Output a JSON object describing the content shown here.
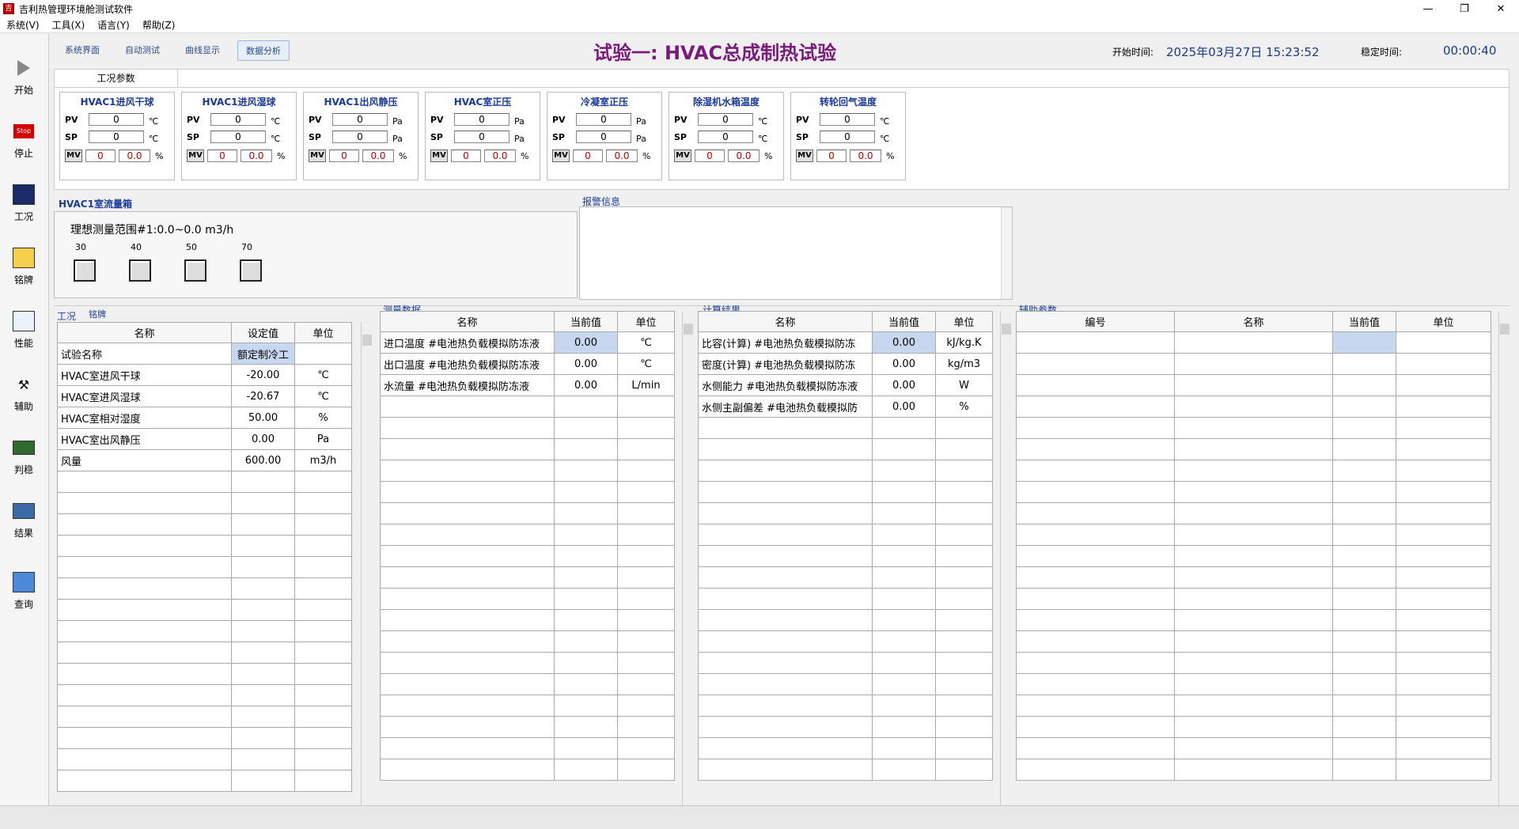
{
  "window": {
    "title": "吉利热管理环境舱测试软件",
    "minimize": "—",
    "maximize": "❐",
    "close": "✕"
  },
  "menu": [
    "系统(V)",
    "工具(X)",
    "语言(Y)",
    "帮助(Z)"
  ],
  "toolbar": [
    {
      "label": "开始",
      "icon": "play-icon"
    },
    {
      "label": "停止",
      "icon": "stop-icon",
      "icon_text": "Stop"
    },
    {
      "label": "工况",
      "icon": "condition-icon"
    },
    {
      "label": "铭牌",
      "icon": "nameplate-icon"
    },
    {
      "label": "性能",
      "icon": "performance-chart-icon"
    },
    {
      "label": "辅助",
      "icon": "assist-icon"
    },
    {
      "label": "判稳",
      "icon": "stability-icon"
    },
    {
      "label": "结果",
      "icon": "result-grid-icon"
    },
    {
      "label": "查询",
      "icon": "query-icon"
    }
  ],
  "tabs": [
    "系统界面",
    "自动测试",
    "曲线显示",
    "数据分析"
  ],
  "header": {
    "title": "试验一: HVAC总成制热试验",
    "start_label": "开始时间:",
    "start_value": "2025年03月27日 15:23:52",
    "stable_label": "稳定时间:",
    "stable_value": "00:00:40"
  },
  "conditions": {
    "tab": "工况参数",
    "labels": {
      "pv": "PV",
      "sp": "SP",
      "mv": "MV"
    },
    "controllers": [
      {
        "title": "HVAC1进风干球",
        "pv": "0",
        "sp": "0",
        "mv1": "0",
        "mv2": "0.0",
        "unit": "℃",
        "mv_unit": "%"
      },
      {
        "title": "HVAC1进风湿球",
        "pv": "0",
        "sp": "0",
        "mv1": "0",
        "mv2": "0.0",
        "unit": "℃",
        "mv_unit": "%"
      },
      {
        "title": "HVAC1出风静压",
        "pv": "0",
        "sp": "0",
        "mv1": "0",
        "mv2": "0.0",
        "unit": "Pa",
        "mv_unit": "%"
      },
      {
        "title": "HVAC室正压",
        "pv": "0",
        "sp": "0",
        "mv1": "0",
        "mv2": "0.0",
        "unit": "Pa",
        "mv_unit": "%"
      },
      {
        "title": "冷凝室正压",
        "pv": "0",
        "sp": "0",
        "mv1": "0",
        "mv2": "0.0",
        "unit": "Pa",
        "mv_unit": "%"
      },
      {
        "title": "除湿机水箱温度",
        "pv": "0",
        "sp": "0",
        "mv1": "0",
        "mv2": "0.0",
        "unit": "℃",
        "mv_unit": "%"
      },
      {
        "title": "转轮回气温度",
        "pv": "0",
        "sp": "0",
        "mv1": "0",
        "mv2": "0.0",
        "unit": "℃",
        "mv_unit": "%"
      }
    ]
  },
  "flow": {
    "title": "HVAC1室流量箱",
    "range": "理想测量范围#1:0.0~0.0 m3/h",
    "nozzles": [
      "30",
      "40",
      "50",
      "70"
    ]
  },
  "alarm": {
    "title": "报警信息"
  },
  "left_tabs": [
    "工况",
    "铭牌"
  ],
  "settings_table": {
    "headers": [
      "名称",
      "设定值",
      "单位"
    ],
    "rows": [
      [
        "试验名称",
        "额定制冷工",
        ""
      ],
      [
        "HVAC室进风干球",
        "-20.00",
        "℃"
      ],
      [
        "HVAC室进风湿球",
        "-20.67",
        "℃"
      ],
      [
        "HVAC室相对湿度",
        "50.00",
        "%"
      ],
      [
        "HVAC室出风静压",
        "0.00",
        "Pa"
      ],
      [
        "风量",
        "600.00",
        "m3/h"
      ]
    ]
  },
  "measure": {
    "title": "测量数据",
    "headers": [
      "名称",
      "当前值",
      "单位"
    ],
    "rows": [
      [
        "进口温度 #电池热负载模拟防冻液",
        "0.00",
        "℃"
      ],
      [
        "出口温度 #电池热负载模拟防冻液",
        "0.00",
        "℃"
      ],
      [
        "水流量 #电池热负载模拟防冻液",
        "0.00",
        "L/min"
      ]
    ]
  },
  "calc": {
    "title": "计算结果",
    "headers": [
      "名称",
      "当前值",
      "单位"
    ],
    "rows": [
      [
        "比容(计算) #电池热负载模拟防冻",
        "0.00",
        "kJ/kg.K"
      ],
      [
        "密度(计算) #电池热负载模拟防冻",
        "0.00",
        "kg/m3"
      ],
      [
        "水侧能力 #电池热负载模拟防冻液",
        "0.00",
        "W"
      ],
      [
        "水侧主副偏差 #电池热负载模拟防",
        "0.00",
        "%"
      ]
    ]
  },
  "aux": {
    "title": "辅助参数",
    "headers": [
      "编号",
      "名称",
      "当前值",
      "单位"
    ]
  }
}
